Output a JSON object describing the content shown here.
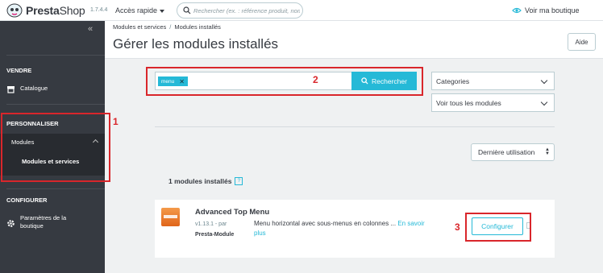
{
  "topbar": {
    "brand_presta": "Presta",
    "brand_shop": "Shop",
    "version": "1.7.4.4",
    "quick_access": "Accès rapide",
    "search_placeholder": "Rechercher (ex. : référence produit, nom",
    "view_shop": "Voir ma boutique"
  },
  "sidebar": {
    "collapse_glyph": "«",
    "section_sell": "VENDRE",
    "catalog": "Catalogue",
    "section_customize": "PERSONNALISER",
    "modules": "Modules",
    "modules_services": "Modules et services",
    "section_configure": "CONFIGURER",
    "shop_params": "Paramètres de la boutique"
  },
  "header": {
    "breadcrumb": [
      "Modules et services",
      "Modules installés"
    ],
    "title": "Gérer les modules installés",
    "help": "Aide"
  },
  "filters": {
    "search_tag": "menu",
    "search_button": "Rechercher",
    "categories": "Categories",
    "view_all": "Voir tous les modules",
    "sort": "Dernière utilisation",
    "installed_count": "1 modules installés",
    "help_mark": "?"
  },
  "module": {
    "name": "Advanced Top Menu",
    "version_by": "v1.13.1 - par",
    "author": "Presta-Module",
    "description": "Menu horizontal avec sous-menus en colonnes ...",
    "learn_more": "En savoir plus",
    "configure": "Configurer"
  },
  "annotations": [
    "1",
    "2",
    "3"
  ],
  "colors": {
    "accent": "#25b9d7",
    "sidebar": "#363a41",
    "annotation": "#d9262b"
  }
}
